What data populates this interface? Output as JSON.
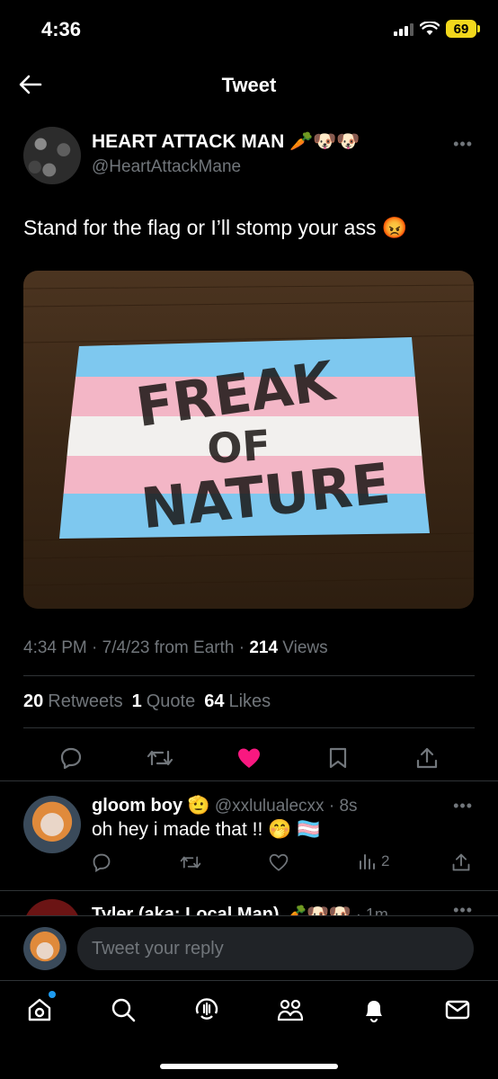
{
  "status": {
    "time": "4:36",
    "battery": "69"
  },
  "header": {
    "title": "Tweet"
  },
  "tweet": {
    "author_name": "HEART ATTACK MAN 🥕🐶🐶",
    "author_handle": "@HeartAttackMane",
    "text": "Stand for the flag or I’ll stomp your ass 😡",
    "image_text_line1": "FREAK",
    "image_text_line2": "OF",
    "image_text_line3": "NATURE",
    "time": "4:34 PM · 7/4/23 from Earth · ",
    "views_count": "214",
    "views_label": " Views",
    "retweets_count": "20",
    "retweets_label": "Retweets",
    "quotes_count": "1",
    "quotes_label": "Quote",
    "likes_count": "64",
    "likes_label": "Likes"
  },
  "reply": {
    "name": "gloom boy 🫡",
    "handle": " @xxlulualecxx · 8s",
    "text": "oh hey i made that !! 🤭 🏳️‍⚧️",
    "views": "2"
  },
  "partial_reply": {
    "name": "Tyler (aka: Local Man) 🥕🐶🐶",
    "time": " · 1m"
  },
  "compose": {
    "placeholder": "Tweet your reply"
  },
  "colors": {
    "accent": "#1d9bf0",
    "like": "#f91880",
    "muted": "#71767b",
    "trans_blue": "#7ec8ef",
    "trans_pink": "#f3b6c6"
  },
  "icons": [
    "back-arrow-icon",
    "more-icon",
    "reply-icon",
    "retweet-icon",
    "like-icon",
    "bookmark-icon",
    "share-icon",
    "views-icon",
    "home-icon",
    "search-icon",
    "spaces-icon",
    "communities-icon",
    "notifications-icon",
    "messages-icon"
  ]
}
